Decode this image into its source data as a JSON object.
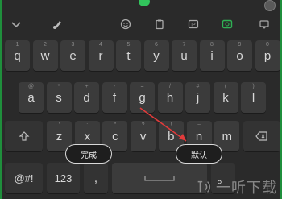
{
  "toolbar": {
    "icons": [
      "chevron-down-icon",
      "brush-icon",
      "emoji-icon",
      "clipboard-icon",
      "translate-icon",
      "keyboard-icon",
      "message-icon"
    ]
  },
  "keyboard": {
    "row1": [
      {
        "label": "q",
        "sup": "1"
      },
      {
        "label": "w",
        "sup": "2"
      },
      {
        "label": "e",
        "sup": "3"
      },
      {
        "label": "r",
        "sup": "4"
      },
      {
        "label": "t",
        "sup": "5"
      },
      {
        "label": "y",
        "sup": "6"
      },
      {
        "label": "u",
        "sup": "7"
      },
      {
        "label": "i",
        "sup": "8"
      },
      {
        "label": "o",
        "sup": "9"
      },
      {
        "label": "p",
        "sup": "0"
      }
    ],
    "row2": [
      {
        "label": "a",
        "sup": "@"
      },
      {
        "label": "s",
        "sup": "*"
      },
      {
        "label": "d",
        "sup": "+"
      },
      {
        "label": "f",
        "sup": "-"
      },
      {
        "label": "g",
        "sup": "="
      },
      {
        "label": "h",
        "sup": "/"
      },
      {
        "label": "j",
        "sup": "#"
      },
      {
        "label": "k",
        "sup": "("
      },
      {
        "label": "l",
        "sup": ")"
      }
    ],
    "row3": [
      {
        "label": "z",
        "sup": "'"
      },
      {
        "label": "x",
        "sup": ":"
      },
      {
        "label": "c",
        "sup": "\""
      },
      {
        "label": "v",
        "sup": "?"
      },
      {
        "label": "b",
        "sup": "!"
      },
      {
        "label": "n",
        "sup": "~"
      },
      {
        "label": "m",
        "sup": "…"
      }
    ],
    "bottom": {
      "symbols": "@#!",
      "numbers": "123",
      "comma": ",",
      "space": "",
      "period": "。"
    }
  },
  "chips": {
    "done": "完成",
    "default": "默认"
  },
  "watermark": {
    "text": "一听下载"
  },
  "colors": {
    "accent": "#1f8f3c",
    "arrow": "#e23b3b"
  }
}
